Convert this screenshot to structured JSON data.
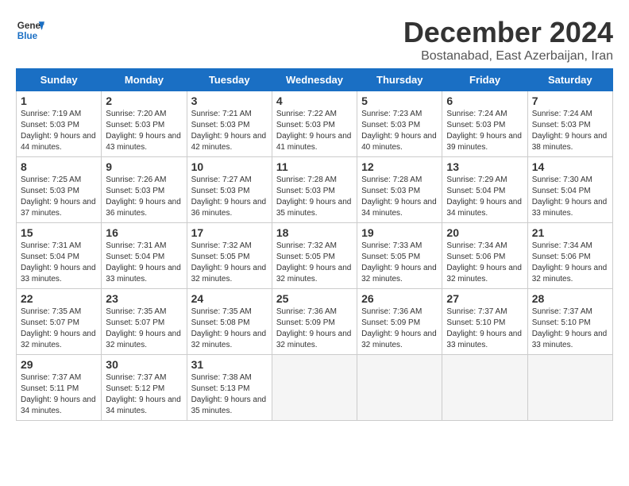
{
  "logo": {
    "line1": "General",
    "line2": "Blue"
  },
  "title": "December 2024",
  "location": "Bostanabad, East Azerbaijan, Iran",
  "days_of_week": [
    "Sunday",
    "Monday",
    "Tuesday",
    "Wednesday",
    "Thursday",
    "Friday",
    "Saturday"
  ],
  "weeks": [
    [
      {
        "day": 1,
        "sunrise": "7:19 AM",
        "sunset": "5:03 PM",
        "daylight": "9 hours and 44 minutes."
      },
      {
        "day": 2,
        "sunrise": "7:20 AM",
        "sunset": "5:03 PM",
        "daylight": "9 hours and 43 minutes."
      },
      {
        "day": 3,
        "sunrise": "7:21 AM",
        "sunset": "5:03 PM",
        "daylight": "9 hours and 42 minutes."
      },
      {
        "day": 4,
        "sunrise": "7:22 AM",
        "sunset": "5:03 PM",
        "daylight": "9 hours and 41 minutes."
      },
      {
        "day": 5,
        "sunrise": "7:23 AM",
        "sunset": "5:03 PM",
        "daylight": "9 hours and 40 minutes."
      },
      {
        "day": 6,
        "sunrise": "7:24 AM",
        "sunset": "5:03 PM",
        "daylight": "9 hours and 39 minutes."
      },
      {
        "day": 7,
        "sunrise": "7:24 AM",
        "sunset": "5:03 PM",
        "daylight": "9 hours and 38 minutes."
      }
    ],
    [
      {
        "day": 8,
        "sunrise": "7:25 AM",
        "sunset": "5:03 PM",
        "daylight": "9 hours and 37 minutes."
      },
      {
        "day": 9,
        "sunrise": "7:26 AM",
        "sunset": "5:03 PM",
        "daylight": "9 hours and 36 minutes."
      },
      {
        "day": 10,
        "sunrise": "7:27 AM",
        "sunset": "5:03 PM",
        "daylight": "9 hours and 36 minutes."
      },
      {
        "day": 11,
        "sunrise": "7:28 AM",
        "sunset": "5:03 PM",
        "daylight": "9 hours and 35 minutes."
      },
      {
        "day": 12,
        "sunrise": "7:28 AM",
        "sunset": "5:03 PM",
        "daylight": "9 hours and 34 minutes."
      },
      {
        "day": 13,
        "sunrise": "7:29 AM",
        "sunset": "5:04 PM",
        "daylight": "9 hours and 34 minutes."
      },
      {
        "day": 14,
        "sunrise": "7:30 AM",
        "sunset": "5:04 PM",
        "daylight": "9 hours and 33 minutes."
      }
    ],
    [
      {
        "day": 15,
        "sunrise": "7:31 AM",
        "sunset": "5:04 PM",
        "daylight": "9 hours and 33 minutes."
      },
      {
        "day": 16,
        "sunrise": "7:31 AM",
        "sunset": "5:04 PM",
        "daylight": "9 hours and 33 minutes."
      },
      {
        "day": 17,
        "sunrise": "7:32 AM",
        "sunset": "5:05 PM",
        "daylight": "9 hours and 32 minutes."
      },
      {
        "day": 18,
        "sunrise": "7:32 AM",
        "sunset": "5:05 PM",
        "daylight": "9 hours and 32 minutes."
      },
      {
        "day": 19,
        "sunrise": "7:33 AM",
        "sunset": "5:05 PM",
        "daylight": "9 hours and 32 minutes."
      },
      {
        "day": 20,
        "sunrise": "7:34 AM",
        "sunset": "5:06 PM",
        "daylight": "9 hours and 32 minutes."
      },
      {
        "day": 21,
        "sunrise": "7:34 AM",
        "sunset": "5:06 PM",
        "daylight": "9 hours and 32 minutes."
      }
    ],
    [
      {
        "day": 22,
        "sunrise": "7:35 AM",
        "sunset": "5:07 PM",
        "daylight": "9 hours and 32 minutes."
      },
      {
        "day": 23,
        "sunrise": "7:35 AM",
        "sunset": "5:07 PM",
        "daylight": "9 hours and 32 minutes."
      },
      {
        "day": 24,
        "sunrise": "7:35 AM",
        "sunset": "5:08 PM",
        "daylight": "9 hours and 32 minutes."
      },
      {
        "day": 25,
        "sunrise": "7:36 AM",
        "sunset": "5:09 PM",
        "daylight": "9 hours and 32 minutes."
      },
      {
        "day": 26,
        "sunrise": "7:36 AM",
        "sunset": "5:09 PM",
        "daylight": "9 hours and 32 minutes."
      },
      {
        "day": 27,
        "sunrise": "7:37 AM",
        "sunset": "5:10 PM",
        "daylight": "9 hours and 33 minutes."
      },
      {
        "day": 28,
        "sunrise": "7:37 AM",
        "sunset": "5:10 PM",
        "daylight": "9 hours and 33 minutes."
      }
    ],
    [
      {
        "day": 29,
        "sunrise": "7:37 AM",
        "sunset": "5:11 PM",
        "daylight": "9 hours and 34 minutes."
      },
      {
        "day": 30,
        "sunrise": "7:37 AM",
        "sunset": "5:12 PM",
        "daylight": "9 hours and 34 minutes."
      },
      {
        "day": 31,
        "sunrise": "7:38 AM",
        "sunset": "5:13 PM",
        "daylight": "9 hours and 35 minutes."
      },
      null,
      null,
      null,
      null
    ]
  ]
}
